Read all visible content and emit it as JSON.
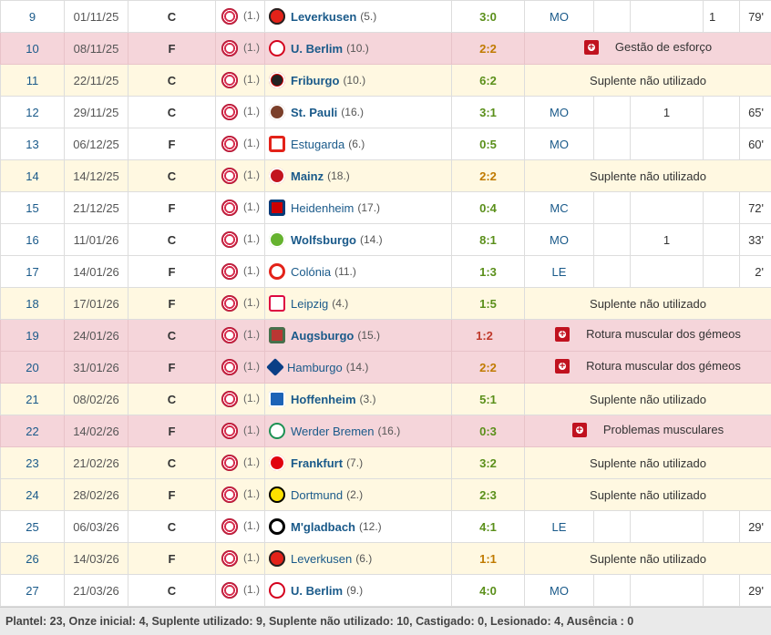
{
  "team_rank": "(1.)",
  "rows": [
    {
      "md": "9",
      "date": "01/11/25",
      "venue": "C",
      "opp": "Leverkusen",
      "opp_bold": true,
      "opp_rank": "(5.)",
      "crest": "k-lev",
      "result": "3:0",
      "rcolor": "g",
      "style": "w",
      "pos": "MO",
      "goals": "1",
      "assists": "",
      "min": "79'"
    },
    {
      "md": "10",
      "date": "08/11/25",
      "venue": "F",
      "opp": "U. Berlim",
      "opp_bold": true,
      "opp_rank": "(10.)",
      "crest": "k-uni",
      "result": "2:2",
      "rcolor": "o",
      "style": "p",
      "note": "Gestão de esforço",
      "injury": true
    },
    {
      "md": "11",
      "date": "22/11/25",
      "venue": "C",
      "opp": "Friburgo",
      "opp_bold": true,
      "opp_rank": "(10.)",
      "crest": "k-fri",
      "result": "6:2",
      "rcolor": "g",
      "style": "y",
      "note": "Suplente não utilizado"
    },
    {
      "md": "12",
      "date": "29/11/25",
      "venue": "C",
      "opp": "St. Pauli",
      "opp_bold": true,
      "opp_rank": "(16.)",
      "crest": "k-stp",
      "result": "3:1",
      "rcolor": "g",
      "style": "w",
      "pos": "MO",
      "goals": "",
      "assists": "1",
      "min": "65'",
      "assists_left": true
    },
    {
      "md": "13",
      "date": "06/12/25",
      "venue": "F",
      "opp": "Estugarda",
      "opp_bold": false,
      "opp_rank": "(6.)",
      "crest": "k-stu",
      "result": "0:5",
      "rcolor": "g",
      "style": "w",
      "pos": "MO",
      "goals": "",
      "assists": "",
      "min": "60'"
    },
    {
      "md": "14",
      "date": "14/12/25",
      "venue": "C",
      "opp": "Mainz",
      "opp_bold": true,
      "opp_rank": "(18.)",
      "crest": "k-mai",
      "result": "2:2",
      "rcolor": "o",
      "style": "y",
      "note": "Suplente não utilizado"
    },
    {
      "md": "15",
      "date": "21/12/25",
      "venue": "F",
      "opp": "Heidenheim",
      "opp_bold": false,
      "opp_rank": "(17.)",
      "crest": "k-hei",
      "result": "0:4",
      "rcolor": "g",
      "style": "w",
      "pos": "MC",
      "goals": "",
      "assists": "",
      "min": "72'"
    },
    {
      "md": "16",
      "date": "11/01/26",
      "venue": "C",
      "opp": "Wolfsburgo",
      "opp_bold": true,
      "opp_rank": "(14.)",
      "crest": "k-wol",
      "result": "8:1",
      "rcolor": "g",
      "style": "w",
      "pos": "MO",
      "goals": "",
      "assists": "1",
      "min": "33'",
      "assists_left": true
    },
    {
      "md": "17",
      "date": "14/01/26",
      "venue": "F",
      "opp": "Colónia",
      "opp_bold": false,
      "opp_rank": "(11.)",
      "crest": "k-col",
      "result": "1:3",
      "rcolor": "g",
      "style": "w",
      "pos": "LE",
      "goals": "",
      "assists": "",
      "min": "2'"
    },
    {
      "md": "18",
      "date": "17/01/26",
      "venue": "F",
      "opp": "Leipzig",
      "opp_bold": false,
      "opp_rank": "(4.)",
      "crest": "k-lei",
      "result": "1:5",
      "rcolor": "g",
      "style": "y",
      "note": "Suplente não utilizado"
    },
    {
      "md": "19",
      "date": "24/01/26",
      "venue": "C",
      "opp": "Augsburgo",
      "opp_bold": true,
      "opp_rank": "(15.)",
      "crest": "k-aug",
      "result": "1:2",
      "rcolor": "r",
      "style": "p",
      "note": "Rotura muscular dos gémeos",
      "injury": true
    },
    {
      "md": "20",
      "date": "31/01/26",
      "venue": "F",
      "opp": "Hamburgo",
      "opp_bold": false,
      "opp_rank": "(14.)",
      "crest": "k-ham",
      "result": "2:2",
      "rcolor": "o",
      "style": "p",
      "note": "Rotura muscular dos gémeos",
      "injury": true
    },
    {
      "md": "21",
      "date": "08/02/26",
      "venue": "C",
      "opp": "Hoffenheim",
      "opp_bold": true,
      "opp_rank": "(3.)",
      "crest": "k-hof",
      "result": "5:1",
      "rcolor": "g",
      "style": "y",
      "note": "Suplente não utilizado"
    },
    {
      "md": "22",
      "date": "14/02/26",
      "venue": "F",
      "opp": "Werder Bremen",
      "opp_bold": false,
      "opp_rank": "(16.)",
      "crest": "k-wer",
      "result": "0:3",
      "rcolor": "g",
      "style": "p",
      "note": "Problemas musculares",
      "injury": true
    },
    {
      "md": "23",
      "date": "21/02/26",
      "venue": "C",
      "opp": "Frankfurt",
      "opp_bold": true,
      "opp_rank": "(7.)",
      "crest": "k-fra",
      "result": "3:2",
      "rcolor": "g",
      "style": "y",
      "note": "Suplente não utilizado"
    },
    {
      "md": "24",
      "date": "28/02/26",
      "venue": "F",
      "opp": "Dortmund",
      "opp_bold": false,
      "opp_rank": "(2.)",
      "crest": "k-dor",
      "result": "2:3",
      "rcolor": "g",
      "style": "y",
      "note": "Suplente não utilizado"
    },
    {
      "md": "25",
      "date": "06/03/26",
      "venue": "C",
      "opp": "M'gladbach",
      "opp_bold": true,
      "opp_rank": "(12.)",
      "crest": "k-mgl",
      "result": "4:1",
      "rcolor": "g",
      "style": "w",
      "pos": "LE",
      "goals": "",
      "assists": "",
      "min": "29'"
    },
    {
      "md": "26",
      "date": "14/03/26",
      "venue": "F",
      "opp": "Leverkusen",
      "opp_bold": false,
      "opp_rank": "(6.)",
      "crest": "k-lev",
      "result": "1:1",
      "rcolor": "o",
      "style": "y",
      "note": "Suplente não utilizado"
    },
    {
      "md": "27",
      "date": "21/03/26",
      "venue": "C",
      "opp": "U. Berlim",
      "opp_bold": true,
      "opp_rank": "(9.)",
      "crest": "k-uni",
      "result": "4:0",
      "rcolor": "g",
      "style": "w",
      "pos": "MO",
      "goals": "",
      "assists": "",
      "min": "29'"
    }
  ],
  "footer": "Plantel: 23, Onze inicial: 4, Suplente utilizado: 9, Suplente não utilizado: 10, Castigado: 0, Lesionado: 4, Ausência : 0"
}
